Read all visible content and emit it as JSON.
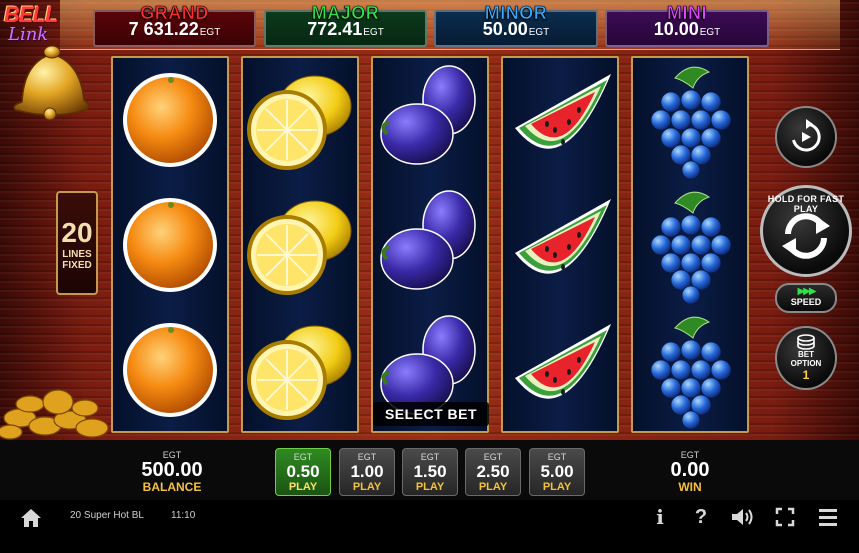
{
  "game": {
    "logo_line1": "BELL",
    "logo_line2": "Link",
    "title": "20 Super Hot BL"
  },
  "jackpots": [
    {
      "name": "GRAND",
      "value": "7 631.22",
      "currency": "EGT",
      "color": "#ff2d2d"
    },
    {
      "name": "MAJOR",
      "value": "772.41",
      "currency": "EGT",
      "color": "#36e04a"
    },
    {
      "name": "MINOR",
      "value": "50.00",
      "currency": "EGT",
      "color": "#36a9ff"
    },
    {
      "name": "MINI",
      "value": "10.00",
      "currency": "EGT",
      "color": "#e043ff"
    }
  ],
  "lines": {
    "count": "20",
    "line1": "LINES",
    "line2": "FIXED"
  },
  "reels": [
    [
      "orange-icon",
      "orange-icon",
      "orange-icon"
    ],
    [
      "lemon-icon",
      "lemon-icon",
      "lemon-icon"
    ],
    [
      "plum-icon",
      "plum-icon",
      "plum-icon"
    ],
    [
      "watermelon-icon",
      "watermelon-icon",
      "watermelon-icon"
    ],
    [
      "grapes-icon",
      "grapes-icon",
      "grapes-icon"
    ]
  ],
  "controls": {
    "select_bet": "SELECT BET",
    "spin_caption": "HOLD FOR FAST PLAY",
    "speed_label": "SPEED",
    "bet_option_label1": "BET",
    "bet_option_label2": "OPTION",
    "bet_option_value": "1"
  },
  "balance": {
    "currency": "EGT",
    "value": "500.00",
    "label": "BALANCE"
  },
  "win": {
    "currency": "EGT",
    "value": "0.00",
    "label": "WIN"
  },
  "bets": [
    {
      "currency": "EGT",
      "value": "0.50",
      "label": "PLAY",
      "selected": true
    },
    {
      "currency": "EGT",
      "value": "1.00",
      "label": "PLAY",
      "selected": false
    },
    {
      "currency": "EGT",
      "value": "1.50",
      "label": "PLAY",
      "selected": false
    },
    {
      "currency": "EGT",
      "value": "2.50",
      "label": "PLAY",
      "selected": false
    },
    {
      "currency": "EGT",
      "value": "5.00",
      "label": "PLAY",
      "selected": false
    }
  ],
  "footer": {
    "clock": "11:10",
    "info_glyph": "i",
    "help_glyph": "?",
    "icons": [
      "home-icon",
      "info-icon",
      "help-icon",
      "sound-icon",
      "fullscreen-icon",
      "menu-icon"
    ]
  },
  "colors": {
    "reel_border": "#c59a4d",
    "active_bet": "#2f8a22",
    "gold_label": "#f4c23c"
  }
}
